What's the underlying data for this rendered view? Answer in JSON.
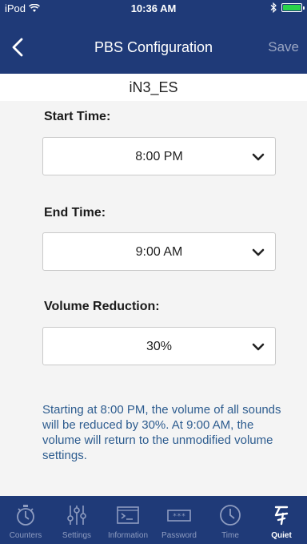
{
  "status_bar": {
    "carrier": "iPod",
    "time": "10:36 AM"
  },
  "nav": {
    "title": "PBS Configuration",
    "save_label": "Save"
  },
  "device_name": "iN3_ES",
  "form": {
    "start_time": {
      "label": "Start Time:",
      "value": "8:00 PM"
    },
    "end_time": {
      "label": "End Time:",
      "value": "9:00 AM"
    },
    "volume_reduction": {
      "label": "Volume Reduction:",
      "value": "30%"
    },
    "description": "Starting at 8:00 PM, the volume of all sounds will be reduced by 30%. At 9:00 AM, the volume will return to the unmodified volume settings."
  },
  "tabs": [
    {
      "label": "Counters",
      "icon": "stopwatch-icon"
    },
    {
      "label": "Settings",
      "icon": "sliders-icon"
    },
    {
      "label": "Information",
      "icon": "terminal-icon"
    },
    {
      "label": "Password",
      "icon": "password-icon"
    },
    {
      "label": "Time",
      "icon": "clock-icon"
    },
    {
      "label": "Quiet",
      "icon": "quiet-icon"
    }
  ],
  "colors": {
    "brand_navy": "#1f3a78",
    "description_text": "#2d5c8f",
    "battery": "#2ad34a"
  }
}
